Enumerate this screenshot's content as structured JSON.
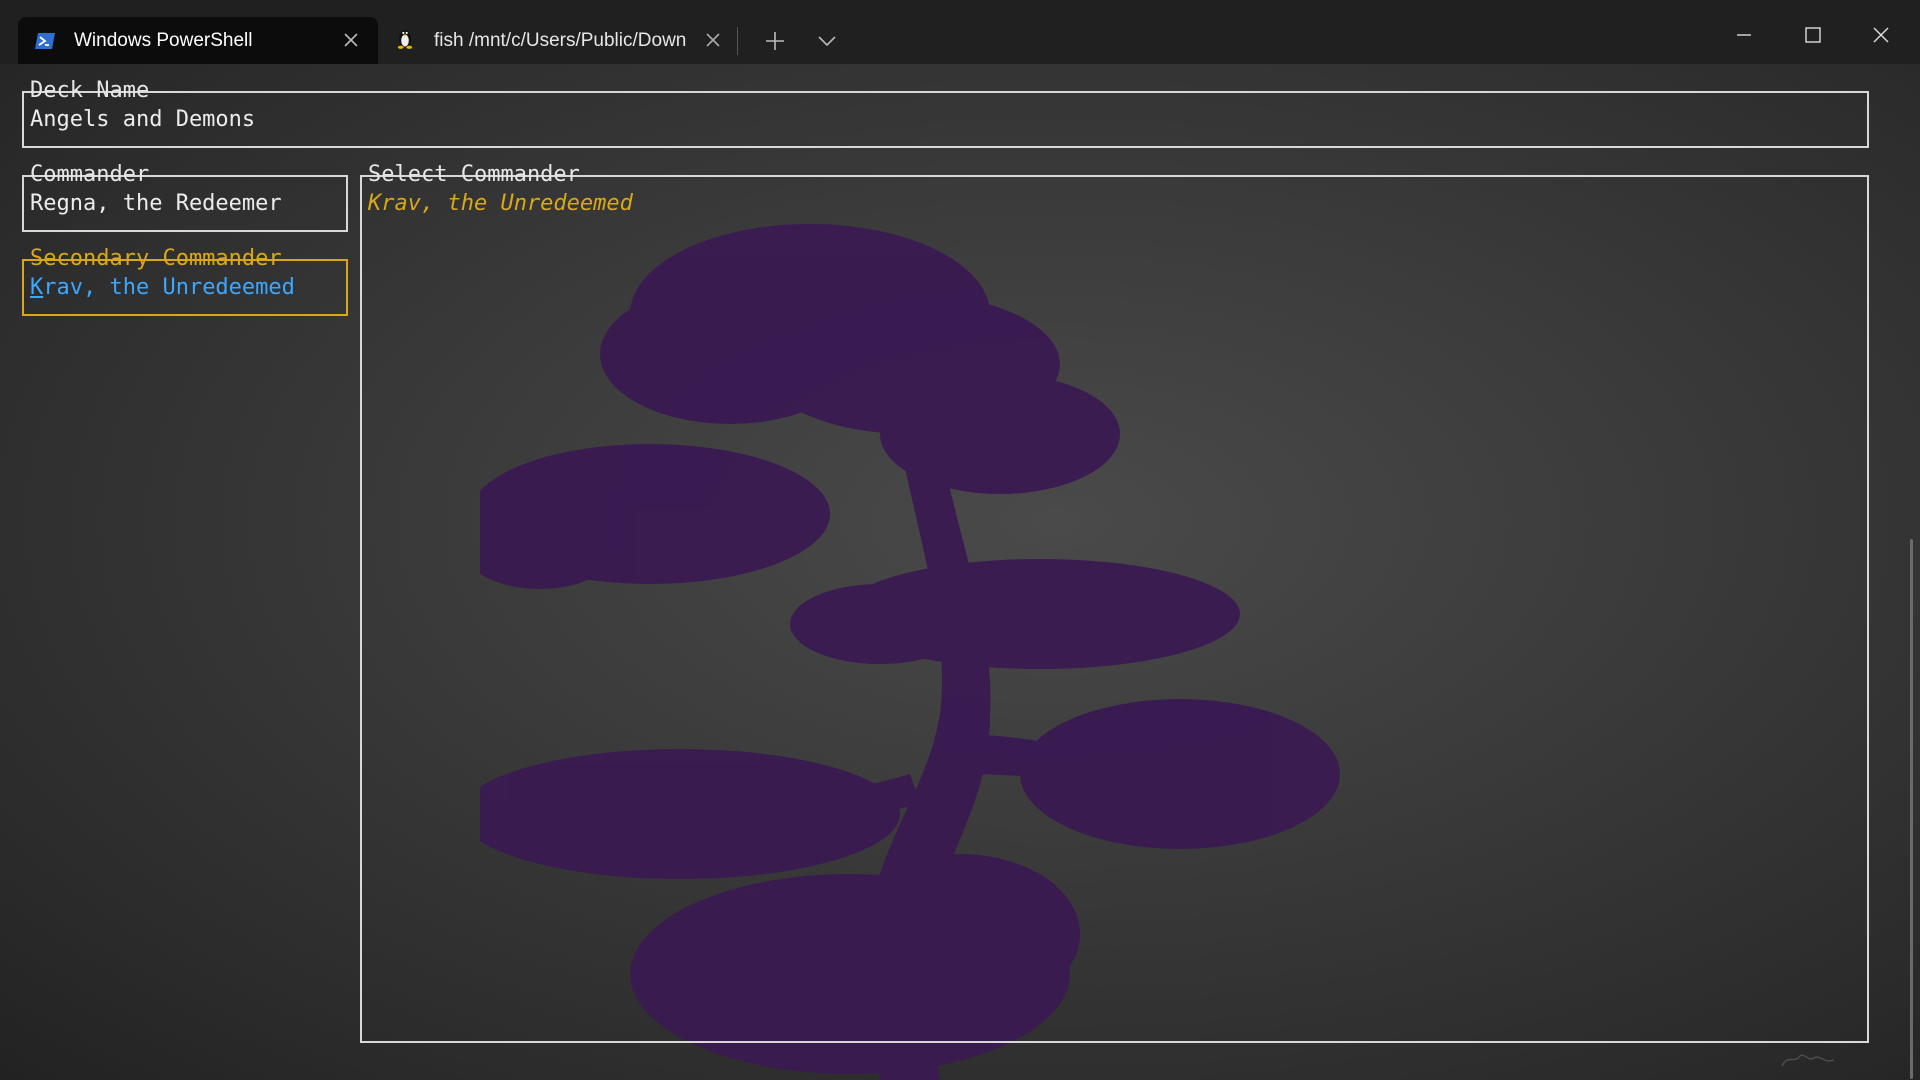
{
  "window": {
    "tabs": [
      {
        "label": "Windows PowerShell",
        "icon": "powershell-icon",
        "active": true
      },
      {
        "label": "fish  /mnt/c/Users/Public/Down",
        "icon": "linux-penguin-icon",
        "active": false
      }
    ],
    "controls": {
      "new_tab_icon": "plus-icon",
      "dropdown_icon": "chevron-down-icon"
    }
  },
  "form": {
    "deck_name": {
      "label": "Deck Name",
      "value": "Angels and Demons"
    },
    "commander": {
      "label": "Commander",
      "value": "Regna, the Redeemer"
    },
    "secondary_commander": {
      "label": "Secondary Commander",
      "value_first": "K",
      "value_rest": "rav, the Unredeemed"
    },
    "select_commander": {
      "label": "Select Commander",
      "highlighted_option": "Krav, the Unredeemed"
    }
  },
  "colors": {
    "accent_focus": "#d9a818",
    "value_focus": "#3ba7ff",
    "tree_silhouette": "#3a1a52"
  }
}
